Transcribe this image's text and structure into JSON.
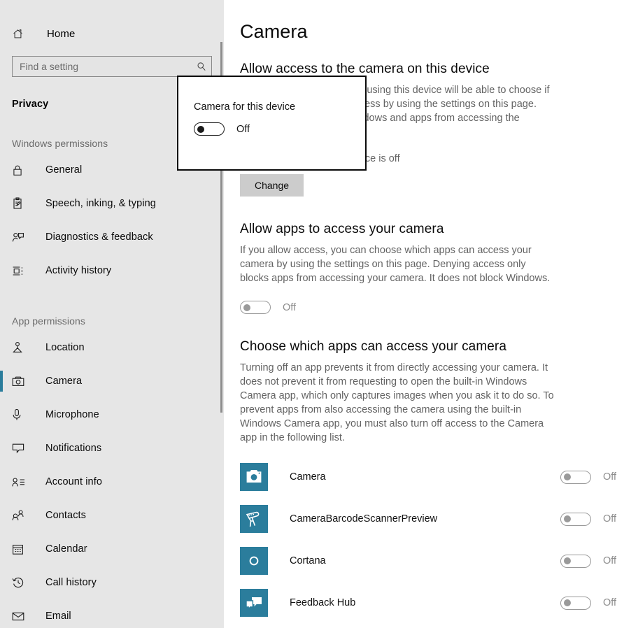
{
  "sidebar": {
    "home": {
      "label": "Home",
      "icon": "home-icon"
    },
    "search": {
      "value": "",
      "placeholder": "Find a setting",
      "icon": "search-icon"
    },
    "section_title": "Privacy",
    "groups": [
      {
        "heading": "Windows permissions",
        "items": [
          {
            "label": "General",
            "icon": "lock-icon",
            "selected": false
          },
          {
            "label": "Speech, inking, & typing",
            "icon": "clipboard-pen-icon",
            "selected": false
          },
          {
            "label": "Diagnostics & feedback",
            "icon": "person-feedback-icon",
            "selected": false
          },
          {
            "label": "Activity history",
            "icon": "timeline-icon",
            "selected": false
          }
        ]
      },
      {
        "heading": "App permissions",
        "items": [
          {
            "label": "Location",
            "icon": "location-pin-icon",
            "selected": false
          },
          {
            "label": "Camera",
            "icon": "camera-icon",
            "selected": true
          },
          {
            "label": "Microphone",
            "icon": "microphone-icon",
            "selected": false
          },
          {
            "label": "Notifications",
            "icon": "speech-bubble-icon",
            "selected": false
          },
          {
            "label": "Account info",
            "icon": "account-info-icon",
            "selected": false
          },
          {
            "label": "Contacts",
            "icon": "contacts-icon",
            "selected": false
          },
          {
            "label": "Calendar",
            "icon": "calendar-icon",
            "selected": false
          },
          {
            "label": "Call history",
            "icon": "clock-history-icon",
            "selected": false
          },
          {
            "label": "Email",
            "icon": "envelope-icon",
            "selected": false
          }
        ]
      }
    ]
  },
  "main": {
    "page_title": "Camera",
    "device_access": {
      "heading": "Allow access to the camera on this device",
      "description": "If you allow access, anyone using this device will be able to choose if their apps have camera access by using the settings on this page. Denying access blocks Windows and apps from accessing the camera.",
      "status": "Camera access for this device is off",
      "change_button": "Change"
    },
    "apps_access": {
      "heading": "Allow apps to access your camera",
      "description": "If you allow access, you can choose which apps can access your camera by using the settings on this page. Denying access only blocks apps from accessing your camera. It does not block Windows.",
      "toggle_state": "Off"
    },
    "choose_apps": {
      "heading": "Choose which apps can access your camera",
      "description": "Turning off an app prevents it from directly accessing your camera. It does not prevent it from requesting to open the built-in Windows Camera app, which only captures images when you ask it to do so. To prevent apps from also accessing the camera using the built-in Windows Camera app, you must also turn off access to the Camera app in the following list.",
      "apps": [
        {
          "name": "Camera",
          "icon": "camera-app-icon",
          "toggle_state": "Off"
        },
        {
          "name": "CameraBarcodeScannerPreview",
          "icon": "barcode-scanner-icon",
          "toggle_state": "Off"
        },
        {
          "name": "Cortana",
          "icon": "cortana-ring-icon",
          "toggle_state": "Off"
        },
        {
          "name": "Feedback Hub",
          "icon": "feedback-hub-icon",
          "toggle_state": "Off"
        }
      ]
    }
  },
  "popup": {
    "title": "Camera for this device",
    "toggle_state": "Off"
  },
  "colors": {
    "accent": "#2b7d9c",
    "sidebar_bg": "#e6e6e6",
    "button_bg": "#cccccc"
  }
}
